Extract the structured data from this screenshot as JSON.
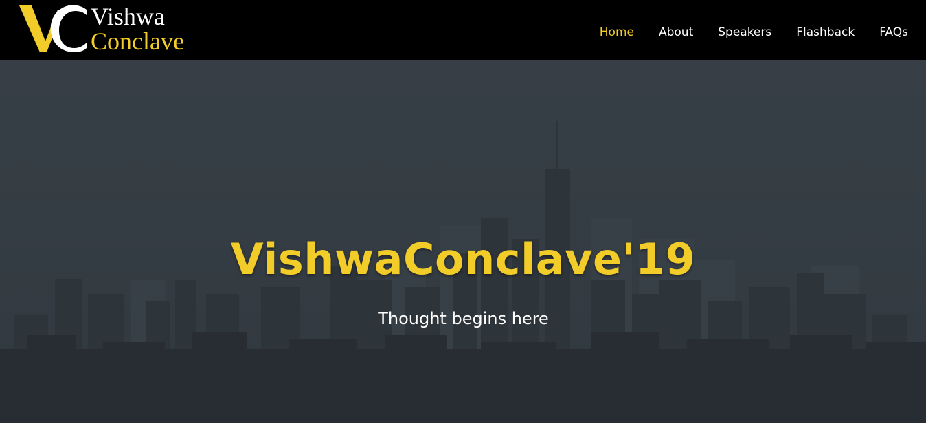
{
  "brand": {
    "monogram": "VC",
    "line1": "Vishwa",
    "line2": "Conclave",
    "accent_color": "#f2cd2a"
  },
  "nav": {
    "items": [
      {
        "label": "Home",
        "active": true
      },
      {
        "label": "About",
        "active": false
      },
      {
        "label": "Speakers",
        "active": false
      },
      {
        "label": "Flashback",
        "active": false
      },
      {
        "label": "FAQs",
        "active": false
      }
    ]
  },
  "hero": {
    "title": "VishwaConclave'19",
    "tagline": "Thought begins here",
    "background": "city-skyline-image"
  }
}
